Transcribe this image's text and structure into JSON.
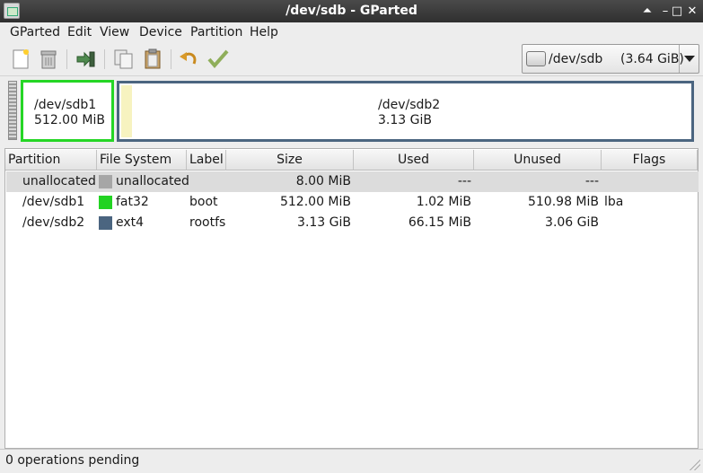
{
  "window": {
    "title": "/dev/sdb - GParted",
    "controls": [
      "⏶",
      "–",
      "□",
      "✕"
    ]
  },
  "menubar": [
    {
      "label": "GParted"
    },
    {
      "label": "Edit"
    },
    {
      "label": "View"
    },
    {
      "label": "Device"
    },
    {
      "label": "Partition"
    },
    {
      "label": "Help"
    }
  ],
  "toolbar": {
    "icons": [
      "new-partition-icon",
      "delete-partition-icon",
      "resize-move-icon",
      "copy-icon",
      "paste-icon",
      "undo-icon",
      "apply-icon"
    ],
    "device": {
      "name": "/dev/sdb",
      "size": "(3.64 GiB)"
    }
  },
  "visual": {
    "sdb1": {
      "name": "/dev/sdb1",
      "size": "512.00 MiB"
    },
    "sdb2": {
      "name": "/dev/sdb2",
      "size": "3.13 GiB"
    }
  },
  "table": {
    "columns": [
      "Partition",
      "File System",
      "Label",
      "Size",
      "Used",
      "Unused",
      "Flags"
    ],
    "rows": [
      {
        "partition": "unallocated",
        "filesystem": "unallocated",
        "fs_color": "#a6a6a6",
        "label": "",
        "size": "8.00 MiB",
        "used": "---",
        "unused": "---",
        "flags": ""
      },
      {
        "partition": "/dev/sdb1",
        "filesystem": "fat32",
        "fs_color": "#22d322",
        "label": "boot",
        "size": "512.00 MiB",
        "used": "1.02 MiB",
        "unused": "510.98 MiB",
        "flags": "lba"
      },
      {
        "partition": "/dev/sdb2",
        "filesystem": "ext4",
        "fs_color": "#4b6580",
        "label": "rootfs",
        "size": "3.13 GiB",
        "used": "66.15 MiB",
        "unused": "3.06 GiB",
        "flags": ""
      }
    ]
  },
  "status": {
    "text": "0 operations pending"
  }
}
